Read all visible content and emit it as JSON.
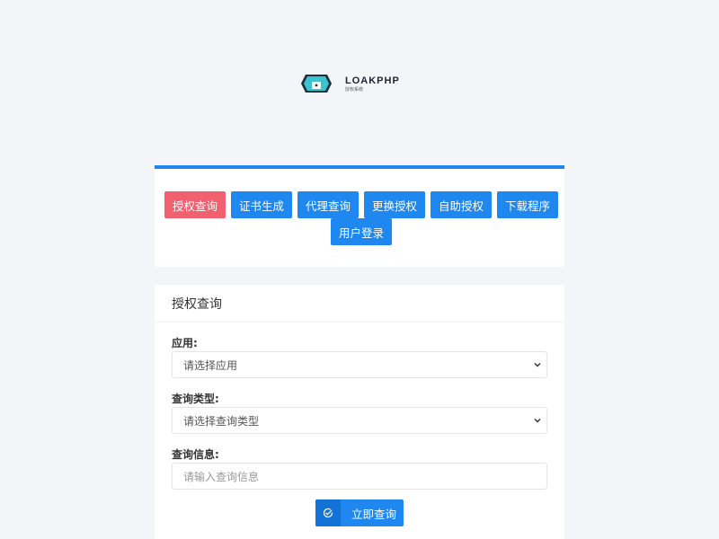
{
  "brand": {
    "title": "LOAKPHP",
    "subtitle": "授权系统"
  },
  "nav": {
    "items": [
      {
        "label": "授权查询",
        "active": true
      },
      {
        "label": "证书生成",
        "active": false
      },
      {
        "label": "代理查询",
        "active": false
      },
      {
        "label": "更换授权",
        "active": false
      },
      {
        "label": "自助授权",
        "active": false
      },
      {
        "label": "下载程序",
        "active": false
      },
      {
        "label": "用户登录",
        "active": false
      }
    ]
  },
  "form": {
    "title": "授权查询",
    "app_label": "应用:",
    "app_select_value": "请选择应用",
    "type_label": "查询类型:",
    "type_select_value": "请选择查询类型",
    "info_label": "查询信息:",
    "info_placeholder": "请输入查询信息",
    "submit_label": "立即查询"
  },
  "colors": {
    "primary": "#1e87f0",
    "active": "#f0606f",
    "background": "#f4f5f9"
  }
}
